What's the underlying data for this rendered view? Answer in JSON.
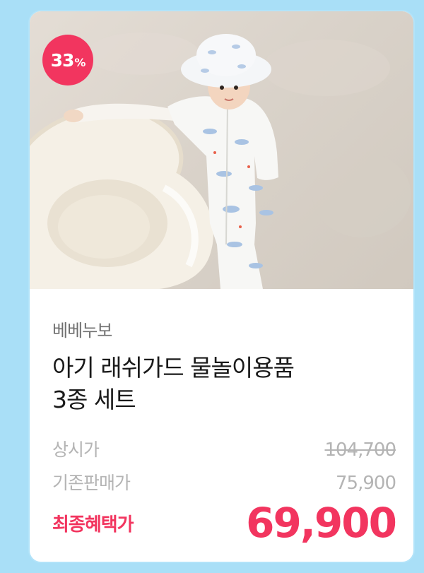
{
  "badge": {
    "discount_number": "33",
    "discount_unit": "%"
  },
  "product": {
    "brand": "베베누보",
    "title_line1": "아기 래쉬가드 물놀이용품",
    "title_line2": "3종 세트"
  },
  "pricing": {
    "list_price_label": "상시가",
    "list_price": "104,700",
    "base_price_label": "기존판매가",
    "base_price": "75,900",
    "final_price_label": "최종혜택가",
    "final_price": "69,900"
  },
  "colors": {
    "background": "#a9dff7",
    "accent": "#f2355f",
    "muted_text": "#b4b4b4",
    "brand_text": "#6f6f6f",
    "title_text": "#1a1a1a"
  },
  "image": {
    "icon": "product-photo-child-in-rashguard-with-swim-ring"
  }
}
